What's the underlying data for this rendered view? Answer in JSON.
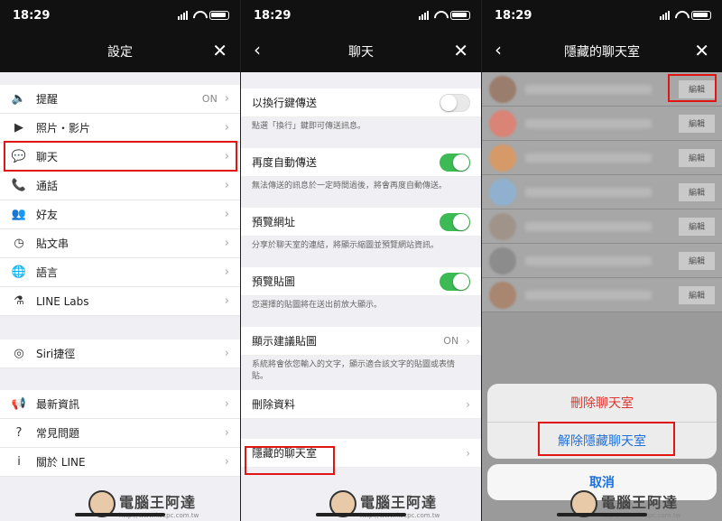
{
  "status": {
    "time": "18:29"
  },
  "panel1": {
    "title": "設定",
    "close": "✕",
    "items_a": [
      {
        "label": "提醒",
        "value": "ON",
        "icon": "speaker-icon",
        "glyph": "🔈"
      },
      {
        "label": "照片・影片",
        "value": "",
        "icon": "media-icon",
        "glyph": "▶"
      },
      {
        "label": "聊天",
        "value": "",
        "icon": "chat-icon",
        "glyph": "💬"
      },
      {
        "label": "通話",
        "value": "",
        "icon": "phone-icon",
        "glyph": "📞"
      },
      {
        "label": "好友",
        "value": "",
        "icon": "friends-icon",
        "glyph": "👥"
      },
      {
        "label": "貼文串",
        "value": "",
        "icon": "timeline-icon",
        "glyph": "◷"
      },
      {
        "label": "語言",
        "value": "",
        "icon": "globe-icon",
        "glyph": "🌐"
      },
      {
        "label": "LINE Labs",
        "value": "",
        "icon": "labs-icon",
        "glyph": "⚗"
      }
    ],
    "items_b": [
      {
        "label": "Siri捷徑",
        "icon": "siri-icon",
        "glyph": "◎"
      }
    ],
    "items_c": [
      {
        "label": "最新資訊",
        "icon": "megaphone-icon",
        "glyph": "📢"
      },
      {
        "label": "常見問題",
        "icon": "help-icon",
        "glyph": "?"
      },
      {
        "label": "關於 LINE",
        "icon": "info-icon",
        "glyph": "i"
      }
    ]
  },
  "panel2": {
    "title": "聊天",
    "close": "✕",
    "back": "‹",
    "settings": [
      {
        "label": "以換行鍵傳送",
        "toggle": "off",
        "desc": "點選「換行」鍵即可傳送訊息。"
      },
      {
        "label": "再度自動傳送",
        "toggle": "on",
        "desc": "無法傳送的訊息於一定時間過後，將會再度自動傳送。"
      },
      {
        "label": "預覽網址",
        "toggle": "on",
        "desc": "分享於聊天室的連結，將顯示縮圖並預覽網站資訊。"
      },
      {
        "label": "預覽貼圖",
        "toggle": "on",
        "desc": "您選擇的貼圖將在送出前放大顯示。"
      }
    ],
    "suggest": {
      "label": "顯示建議貼圖",
      "value": "ON",
      "desc": "系統將會依您輸入的文字，顯示適合該文字的貼圖或表情貼。"
    },
    "delete_data": "刪除資料",
    "hidden_chats": "隱藏的聊天室"
  },
  "panel3": {
    "title": "隱藏的聊天室",
    "close": "✕",
    "back": "‹",
    "edit_label": "編輯",
    "rows": [
      {
        "color": "#9b7d6e"
      },
      {
        "color": "#d98476"
      },
      {
        "color": "#d69a68"
      },
      {
        "color": "#8fb1cf"
      },
      {
        "color": "#a0948a"
      },
      {
        "color": "#8c8c8c"
      },
      {
        "color": "#a88670"
      }
    ],
    "sheet": {
      "delete": "刪除聊天室",
      "unhide": "解除隱藏聊天室",
      "cancel": "取消"
    }
  },
  "watermark": {
    "text": "電腦王阿達",
    "url": "http://www.kocpc.com.tw"
  },
  "colors": {
    "highlight": "#e01616",
    "toggle_on": "#3cba54",
    "destructive": "#e0332d",
    "action": "#1e6fd9"
  }
}
